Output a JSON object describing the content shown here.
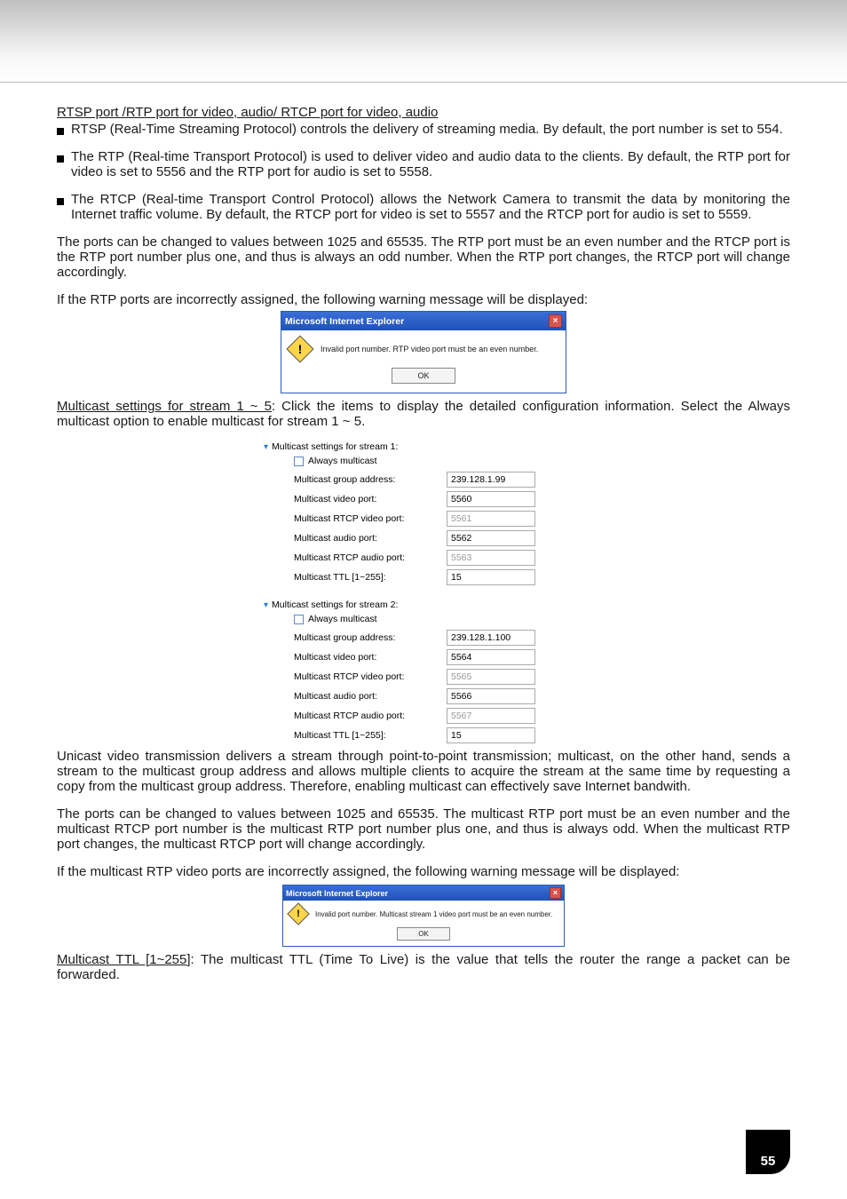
{
  "headings": {
    "rtsp": "RTSP port /RTP port for video, audio/ RTCP port for video, audio",
    "multicast_settings": "Multicast settings for stream 1 ~ 5",
    "multicast_ttl": "Multicast TTL [1~255]"
  },
  "bullets": {
    "b1": "RTSP (Real-Time Streaming Protocol) controls the delivery of streaming media. By default, the port number is set to 554.",
    "b2": "The RTP (Real-time Transport Protocol) is used to deliver video and audio data to the clients. By default, the RTP port for video is set to 5556 and the RTP port for audio is set to 5558.",
    "b3": "The RTCP (Real-time Transport Control Protocol) allows the Network Camera to transmit the data by monitoring the Internet traffic volume. By default, the RTCP port for video is set to 5557 and the RTCP port for audio is set to 5559."
  },
  "paras": {
    "p1": "The ports can be changed to values between 1025 and 65535. The RTP port must be an even number and the RTCP port is the RTP port number plus one, and thus is always an odd number. When the RTP port changes, the RTCP port will change accordingly.",
    "p2": "If the RTP ports are incorrectly assigned, the following warning message will be displayed:",
    "p3_suffix": ": Click the items to display the detailed configuration information. Select the Always multicast option to enable multicast for stream 1 ~ 5.",
    "p4": "Unicast video transmission delivers a stream through point-to-point transmission; multicast, on the other hand, sends a stream to the multicast group address and allows multiple clients to acquire the stream at the same time by requesting a copy from the multicast group address. Therefore, enabling multicast can effectively save Internet bandwith.",
    "p5": "The ports can be changed to values between 1025 and 65535. The multicast RTP port must be an even number and the multicast RTCP port number is the multicast RTP port number plus one, and thus is always odd. When the multicast RTP port changes, the multicast RTCP port will change accordingly.",
    "p6": "If the multicast RTP video ports are incorrectly assigned, the following warning message will be displayed:",
    "p7_suffix": ": The multicast TTL (Time To Live) is the value that tells the router the range a packet can be forwarded."
  },
  "dialog1": {
    "title": "Microsoft Internet Explorer",
    "msg": "Invalid port number. RTP video port must be an even number.",
    "ok": "OK"
  },
  "dialog2": {
    "title": "Microsoft Internet Explorer",
    "msg": "Invalid port number. Multicast stream 1 video port must be an even number.",
    "ok": "OK"
  },
  "form": {
    "stream1_title": "Multicast settings for stream 1:",
    "stream2_title": "Multicast settings for stream 2:",
    "always": "Always multicast",
    "labels": {
      "group": "Multicast group address:",
      "video": "Multicast video port:",
      "rtcp_video": "Multicast RTCP video port:",
      "audio": "Multicast audio port:",
      "rtcp_audio": "Multicast RTCP audio port:",
      "ttl": "Multicast TTL [1~255]:"
    },
    "s1": {
      "group": "239.128.1.99",
      "video": "5560",
      "rtcp_video": "5561",
      "audio": "5562",
      "rtcp_audio": "5563",
      "ttl": "15"
    },
    "s2": {
      "group": "239.128.1.100",
      "video": "5564",
      "rtcp_video": "5565",
      "audio": "5566",
      "rtcp_audio": "5567",
      "ttl": "15"
    }
  },
  "page_number": "55"
}
